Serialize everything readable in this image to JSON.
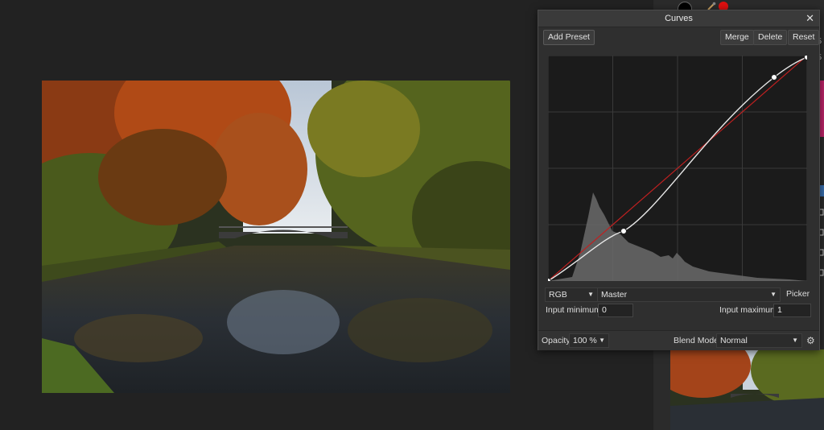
{
  "dialog": {
    "title": "Curves",
    "buttons": {
      "add_preset": "Add Preset",
      "merge": "Merge",
      "delete": "Delete",
      "reset": "Reset"
    },
    "channel_select": "RGB",
    "mode_select": "Master",
    "picker_label": "Picker",
    "input_minimum_label": "Input minimum:",
    "input_minimum_value": "0",
    "input_maximum_label": "Input maximum:",
    "input_maximum_value": "1",
    "opacity_label": "Opacity:",
    "opacity_value": "100 %",
    "blend_mode_label": "Blend Mode:",
    "blend_mode_value": "Normal"
  },
  "icons": [
    "close-icon",
    "chevron-down-icon",
    "gear-icon",
    "eyedropper-icon"
  ],
  "colors": {
    "curve": "#e8e8e8",
    "diagonal": "#c02020",
    "histogram": "#6a6a6a",
    "graph_bg": "#1b1b1b"
  },
  "right_panel_labels": [
    "5",
    "5"
  ]
}
